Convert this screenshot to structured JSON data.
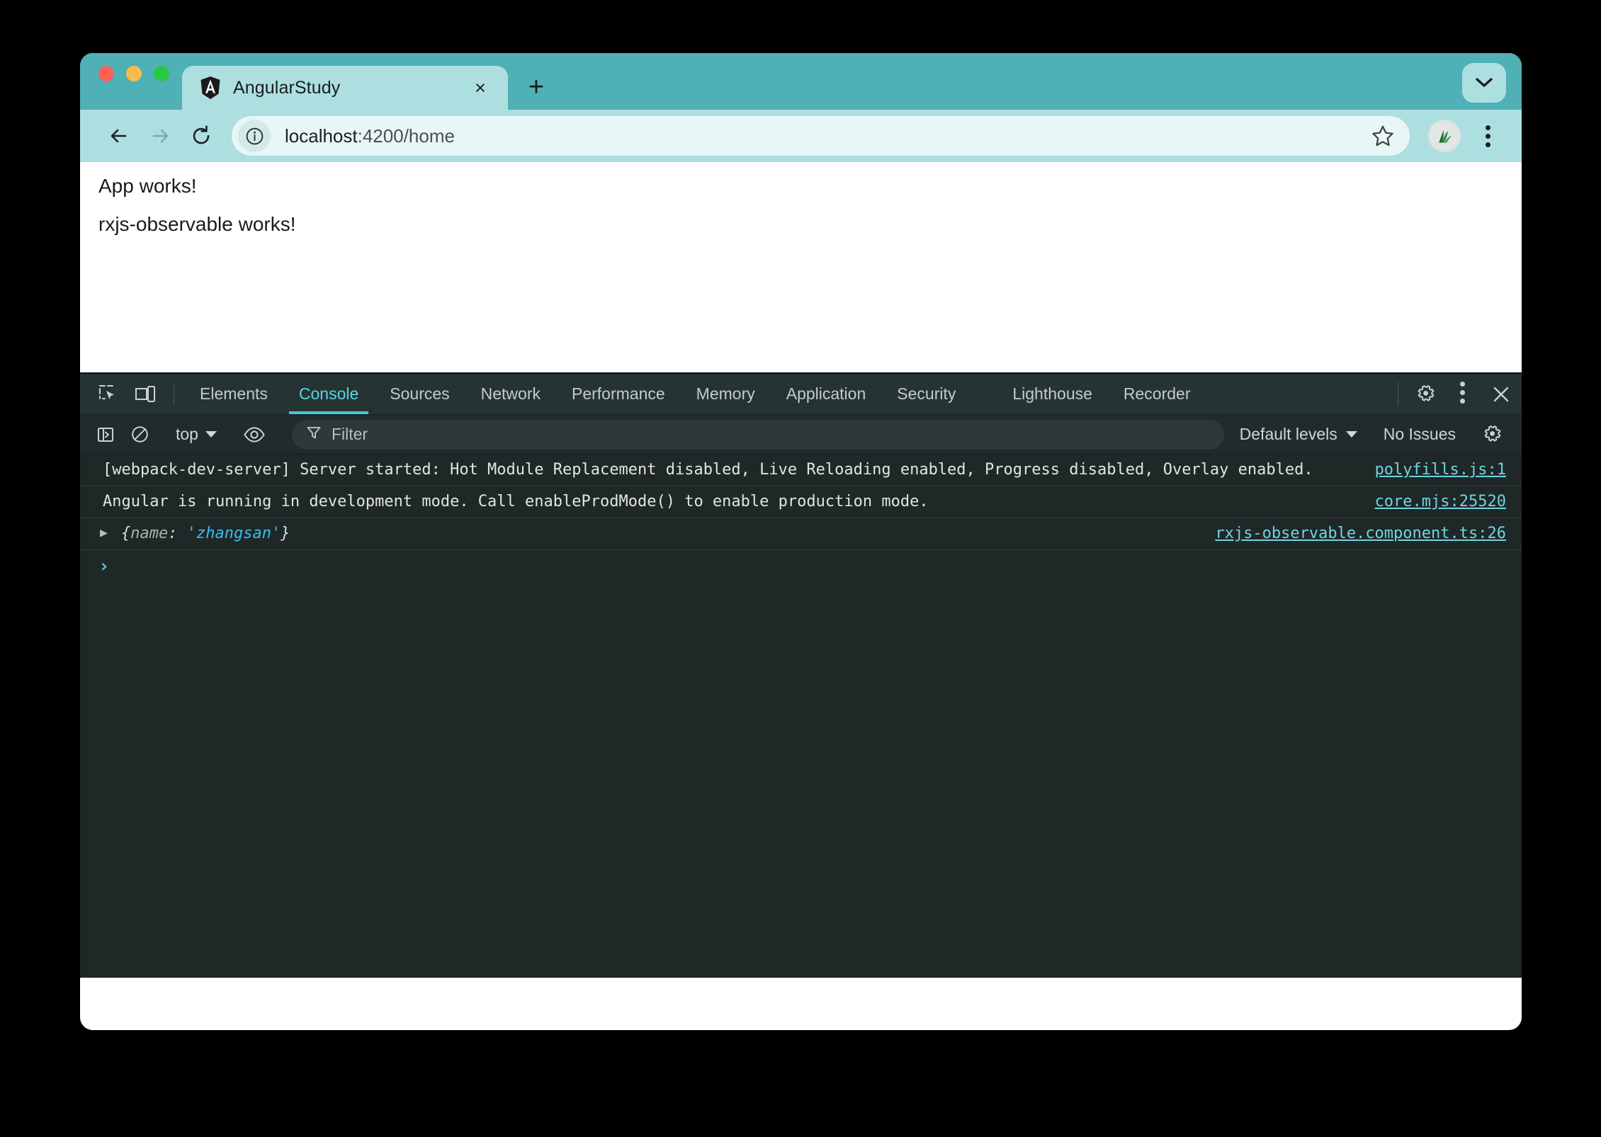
{
  "window": {
    "traffic_lights": [
      "close",
      "minimize",
      "maximize"
    ],
    "chevron_icon": "chevron-down-icon"
  },
  "tab": {
    "title": "AngularStudy",
    "favicon": "angular-logo-icon",
    "close_label": "×",
    "new_tab_label": "+"
  },
  "toolbar": {
    "back_icon": "arrow-left-icon",
    "forward_icon": "arrow-right-icon",
    "reload_icon": "reload-icon",
    "site_info_icon": "info-circle-icon",
    "url_host": "localhost",
    "url_path": ":4200/home",
    "url_full": "localhost:4200/home",
    "star_icon": "star-outline-icon",
    "avatar_icon": "profile-avatar",
    "menu_icon": "kebab-menu-icon"
  },
  "page": {
    "lines": [
      "App works!",
      "rxjs-observable works!"
    ]
  },
  "devtools": {
    "inspect_icon": "inspect-element-icon",
    "device_icon": "device-toolbar-icon",
    "tabs": [
      {
        "label": "Elements",
        "active": false
      },
      {
        "label": "Console",
        "active": true
      },
      {
        "label": "Sources",
        "active": false
      },
      {
        "label": "Network",
        "active": false
      },
      {
        "label": "Performance",
        "active": false
      },
      {
        "label": "Memory",
        "active": false
      },
      {
        "label": "Application",
        "active": false
      },
      {
        "label": "Security",
        "active": false
      }
    ],
    "tabs_overflow": [
      {
        "label": "Lighthouse",
        "active": false
      },
      {
        "label": "Recorder",
        "active": false
      }
    ],
    "settings_icon": "gear-icon",
    "more_icon": "kebab-menu-icon",
    "close_icon": "close-icon",
    "console_toolbar": {
      "sidebar_icon": "console-sidebar-icon",
      "clear_icon": "clear-console-icon",
      "context": "top",
      "eye_icon": "live-expression-eye-icon",
      "filter_icon": "filter-funnel-icon",
      "filter_placeholder": "Filter",
      "filter_value": "",
      "levels": "Default levels",
      "issues": "No Issues",
      "settings_icon": "gear-icon"
    },
    "console_messages": [
      {
        "text": "[webpack-dev-server] Server started: Hot Module Replacement disabled, Live Reloading enabled, Progress disabled, Overlay enabled.",
        "source": "polyfills.js:1",
        "expandable": false
      },
      {
        "text": "Angular is running in development mode. Call enableProdMode() to enable production mode.",
        "source": "core.mjs:25520",
        "expandable": false
      },
      {
        "object": {
          "open": "{",
          "key": "name",
          "colon": ":",
          "value": "'zhangsan'",
          "close": "}"
        },
        "source": "rxjs-observable.component.ts:26",
        "expandable": true,
        "disclosure_icon": "triangle-right-icon"
      }
    ],
    "prompt_caret": "›"
  },
  "colors": {
    "tabstrip_bg": "#4fb0b6",
    "toolbar_bg": "#addfe0",
    "omnibox_bg": "#e8f6f5",
    "devtools_bg": "#1f2727",
    "devtools_tabbar_bg": "#263333",
    "accent_cyan": "#45c7d8",
    "link_cyan": "#6fd4e0",
    "string_blue": "#39bdf0"
  }
}
